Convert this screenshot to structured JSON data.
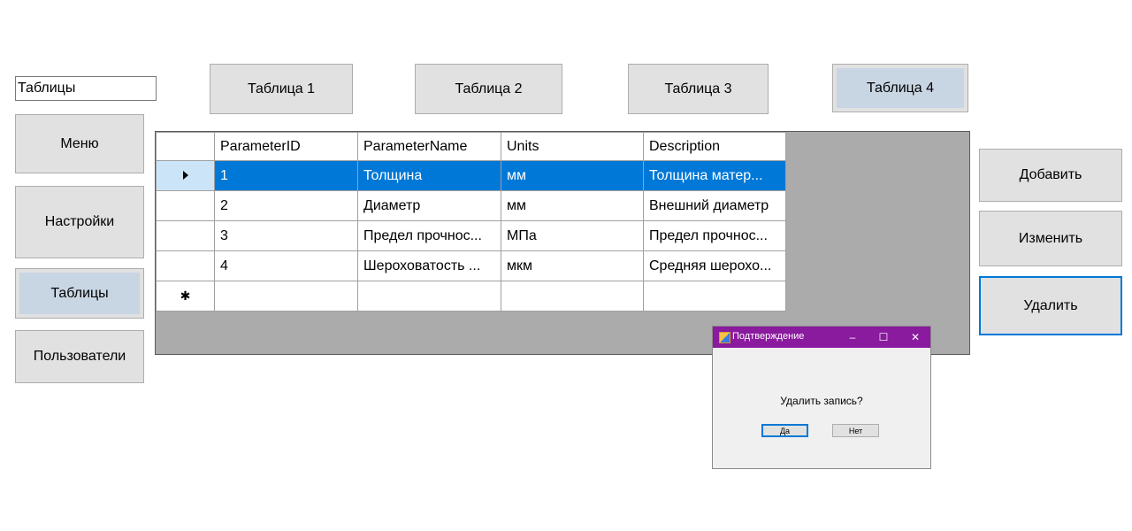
{
  "section_label": "Таблицы",
  "nav": {
    "menu": "Меню",
    "settings": "Настройки",
    "tables": "Таблицы",
    "users": "Пользователи"
  },
  "table_tabs": [
    "Таблица 1",
    "Таблица 2",
    "Таблица 3",
    "Таблица 4"
  ],
  "grid": {
    "columns": [
      "ParameterID",
      "ParameterName",
      "Units",
      "Description"
    ],
    "rows": [
      [
        "1",
        "Толщина",
        "мм",
        "Толщина матер..."
      ],
      [
        "2",
        "Диаметр",
        "мм",
        "Внешний диаметр"
      ],
      [
        "3",
        "Предел прочнос...",
        "МПа",
        "Предел прочнос..."
      ],
      [
        "4",
        "Шероховатость ...",
        "мкм",
        "Средняя шерохо..."
      ]
    ]
  },
  "actions": {
    "add": "Добавить",
    "edit": "Изменить",
    "delete": "Удалить"
  },
  "dialog": {
    "title": "Подтверждение",
    "message": "Удалить запись?",
    "yes": "Да",
    "no": "Нет",
    "minimize": "–",
    "maximize": "☐",
    "close": "✕"
  },
  "colors": {
    "accent": "#0078d7",
    "dialog_title": "#8a1a9e",
    "active_tab": "#c8d5e3"
  }
}
